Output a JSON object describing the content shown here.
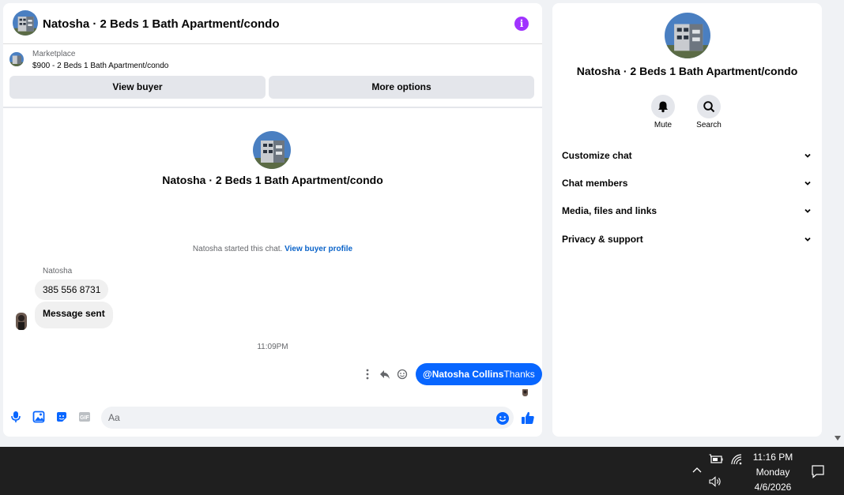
{
  "chat": {
    "title": "Natosha · 2 Beds 1 Bath Apartment/condo",
    "info_icon": "i",
    "marketplace": {
      "label": "Marketplace",
      "item": "$900 - 2 Beds 1 Bath Apartment/condo"
    },
    "buttons": {
      "view_buyer": "View buyer",
      "more_options": "More options"
    },
    "center_name": "Natosha · 2 Beds 1 Bath Apartment/condo",
    "started_text": "Natosha started this chat.",
    "started_link": "View buyer profile",
    "sender_name": "Natosha",
    "messages_in": [
      "385 556 8731",
      "Message sent"
    ],
    "timestamp": "11:09PM",
    "message_out": {
      "mention": "@Natosha Collins",
      "text": "Thanks"
    },
    "composer": {
      "placeholder": "Aa",
      "gif_label": "GIF"
    }
  },
  "info_panel": {
    "title": "Natosha · 2 Beds 1 Bath Apartment/condo",
    "actions": [
      {
        "label": "Mute",
        "icon": "bell-icon"
      },
      {
        "label": "Search",
        "icon": "search-icon"
      }
    ],
    "sections": [
      "Customize chat",
      "Chat members",
      "Media, files and links",
      "Privacy & support"
    ]
  },
  "taskbar": {
    "time": "11:16 PM",
    "day": "Monday",
    "date": "4/6/2026"
  },
  "colors": {
    "accent": "#0866ff",
    "info_purple": "#a033ff",
    "link": "#0a63c9",
    "taskbar": "#1f1f1f"
  }
}
